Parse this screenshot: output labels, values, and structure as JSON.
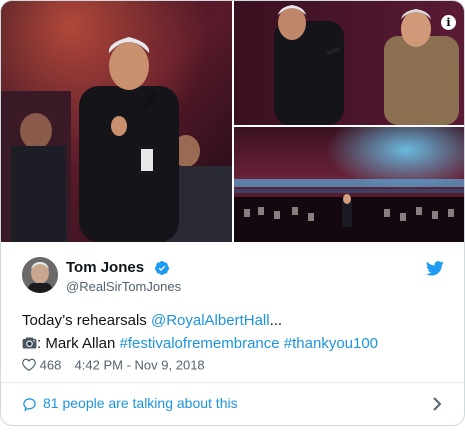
{
  "tweet": {
    "author_name": "Tom Jones",
    "author_handle": "@RealSirTomJones",
    "text_plain": "Today’s rehearsals ",
    "mention": "@RoyalAlbertHall",
    "ellipsis": "...",
    "credit_prefix": ": Mark Allan ",
    "hashtag1": "#festivalofremembrance",
    "hashtag2": "#thankyou100",
    "likes": "468",
    "timestamp": "4:42 PM - Nov 9, 2018",
    "talking": "81 people are talking about this"
  },
  "icons": {
    "media_info": "info-icon",
    "verified": "verified-badge-icon",
    "platform": "twitter-bird-icon",
    "camera": "camera-icon",
    "like": "heart-icon",
    "reply": "speech-bubble-icon",
    "expand": "chevron-right-icon"
  },
  "colors": {
    "link": "#1b95e0",
    "text": "#0f1419",
    "muted": "#536471",
    "border": "#cfd9de"
  }
}
